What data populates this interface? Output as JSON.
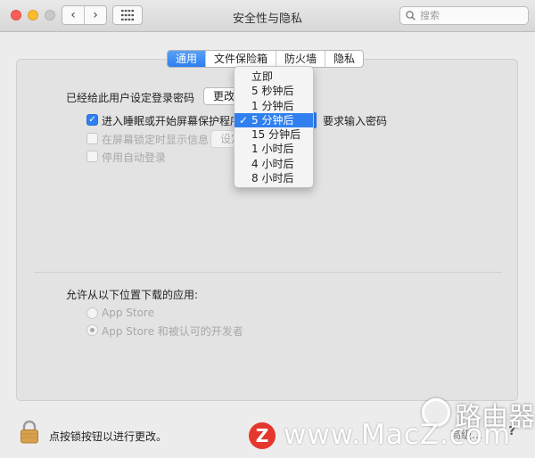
{
  "window": {
    "title": "安全性与隐私"
  },
  "toolbar": {
    "back": "‹",
    "forward": "›",
    "search_placeholder": "搜索"
  },
  "tabs": [
    {
      "label": "通用",
      "active": true
    },
    {
      "label": "文件保险箱",
      "active": false
    },
    {
      "label": "防火墙",
      "active": false
    },
    {
      "label": "隐私",
      "active": false
    }
  ],
  "general": {
    "password_set_label": "已经给此用户设定登录密码",
    "change_password_button": "更改密码…",
    "require_password_checkbox": "进入睡眠或开始屏幕保护程序",
    "require_password_checked": true,
    "require_password_suffix": "要求输入密码",
    "show_message_label": "在屏幕锁定时显示信息",
    "set_message_button": "设定锁定信息…",
    "disable_autologin_label": "停用自动登录",
    "download_label": "允许从以下位置下载的应用:",
    "radio_app_store": "App Store",
    "radio_app_store_dev": "App Store 和被认可的开发者"
  },
  "password_delay_menu": {
    "items": [
      "立即",
      "5 秒钟后",
      "1 分钟后",
      "5 分钟后",
      "15 分钟后",
      "1 小时后",
      "4 小时后",
      "8 小时后"
    ],
    "selected": "5 分钟后",
    "check": "✓"
  },
  "footer": {
    "lock_label": "点按锁按钮以进行更改。",
    "advanced": "高级…",
    "help": "?"
  },
  "watermark": {
    "logo": "Z",
    "text": "www.MacZ.com",
    "corner": "路由器"
  },
  "colors": {
    "accent": "#2f7ff0",
    "close": "#fc5f57",
    "minimize": "#fdbb2e",
    "watermark_red": "#e4372e"
  }
}
